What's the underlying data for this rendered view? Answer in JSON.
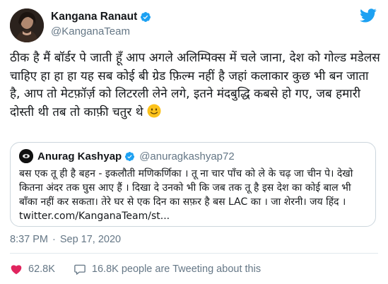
{
  "author": {
    "display_name": "Kangana Ranaut",
    "handle": "@KanganaTeam",
    "verified": true
  },
  "tweet": {
    "text": "ठीक है मैं बॉर्डर पे जाती हूँ आप अगले अलिम्पिक्स में चले जाना, देश को गोल्ड मडेलस चाहिए हा हा हा यह सब कोई बी ग्रेड फ़िल्म नहीं है जहां कलाकार कुछ भी बन जाता है, आप तो मेटफ़ॉर्ज़ को लिटरली लेने लगे, इतने मंदबुद्धि कबसे हो गए, जब हमारी दोस्ती थी तब तो काफ़ी चतुर थे",
    "emoji": "slightly-smiling-face-icon"
  },
  "quoted_tweet": {
    "display_name": "Anurag Kashyap",
    "handle": "@anuragkashyap72",
    "verified": true,
    "text": "बस एक तू ही है बहन - इकलौती मणिकर्णिका । तू ना चार पाँच को ले के चढ़ जा चीन पे। देखो कितना अंदर तक घुस आए हैं । दिखा दे उनको भी कि जब तक तू है इस देश का कोई बाल भी बाँका नहीं कर सकता। तेरे घर से एक दिन का सफ़र है बस LAC का । जा शेरनी। जय हिंद । twitter.com/KanganaTeam/st..."
  },
  "meta": {
    "time": "8:37 PM",
    "separator": "·",
    "date": "Sep 17, 2020"
  },
  "actions": {
    "likes": "62.8K",
    "people_tweeting": "16.8K people are Tweeting about this"
  },
  "colors": {
    "twitter_blue": "#1da1f2",
    "like_red": "#e0245e",
    "text_primary": "#14171a",
    "text_secondary": "#657786",
    "border": "#ccd6dd"
  }
}
